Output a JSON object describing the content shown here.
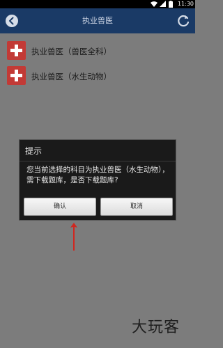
{
  "statusbar": {
    "time": "11:30"
  },
  "appbar": {
    "title": "执业兽医"
  },
  "list": {
    "items": [
      {
        "label": "执业兽医（兽医全科）"
      },
      {
        "label": "执业兽医（水生动物）"
      }
    ]
  },
  "dialog": {
    "title": "提示",
    "message": "您当前选择的科目为执业兽医（水生动物），需下载题库，是否下载题库?",
    "confirm_label": "确认",
    "cancel_label": "取消"
  },
  "watermark": {
    "text": "大玩客"
  },
  "colors": {
    "accent_red": "#c23a36",
    "appbar_bg": "#1a3a66",
    "dialog_bg": "#1a1a1a"
  }
}
